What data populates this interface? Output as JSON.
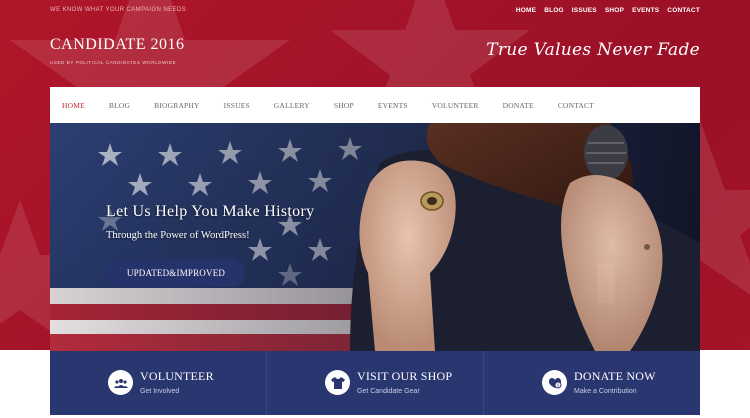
{
  "utility": {
    "tagline": "WE KNOW WHAT YOUR CAMPAIGN NEEDS",
    "menu": [
      "HOME",
      "BLOG",
      "ISSUES",
      "SHOP",
      "EVENTS",
      "CONTACT"
    ]
  },
  "brand": {
    "title": "CANDIDATE 2016",
    "subtitle": "USED BY POLITICAL CANDIDATES WORLDWIDE"
  },
  "slogan": "True Values Never Fade",
  "nav": {
    "items": [
      "HOME",
      "BLOG",
      "BIOGRAPHY",
      "ISSUES",
      "GALLERY",
      "SHOP",
      "EVENTS",
      "VOLUNTEER",
      "DONATE",
      "CONTACT"
    ],
    "active": "HOME"
  },
  "hero": {
    "title": "Let Us Help You Make History",
    "subtitle": "Through the Power of WordPress!",
    "button_label": "UPDATED&IMPROVED"
  },
  "features": [
    {
      "title": "VOLUNTEER",
      "subtitle": "Get Involved",
      "icon": "group-icon"
    },
    {
      "title": "VISIT OUR SHOP",
      "subtitle": "Get Candidate Gear",
      "icon": "tshirt-icon"
    },
    {
      "title": "DONATE NOW",
      "subtitle": "Make a Contribution",
      "icon": "donate-icon"
    }
  ],
  "colors": {
    "header_red": "#a3132a",
    "nav_active": "#c0262f",
    "feature_blue": "#2a3670",
    "button_blue": "#26326a"
  }
}
